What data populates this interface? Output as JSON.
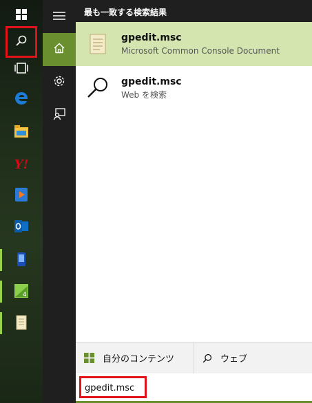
{
  "taskbar": {
    "items": [
      {
        "name": "start-button",
        "icon": "windows-logo-icon"
      },
      {
        "name": "search-button",
        "icon": "search-icon"
      },
      {
        "name": "task-view-button",
        "icon": "task-view-icon"
      },
      {
        "name": "edge-button",
        "icon": "edge-icon"
      },
      {
        "name": "file-explorer-button",
        "icon": "folder-icon"
      },
      {
        "name": "yahoo-button",
        "icon": "yahoo-icon",
        "label": "Y!"
      },
      {
        "name": "media-player-button",
        "icon": "media-player-icon"
      },
      {
        "name": "outlook-button",
        "icon": "outlook-icon"
      },
      {
        "name": "app-button-1",
        "icon": "app-icon"
      },
      {
        "name": "app-button-2",
        "icon": "app-icon"
      },
      {
        "name": "notepad-button",
        "icon": "notepad-icon"
      }
    ],
    "accent_color": "#9ad14a",
    "highlight_color": "#e2121b"
  },
  "rail": {
    "items": [
      {
        "name": "menu",
        "icon": "hamburger-icon"
      },
      {
        "name": "home",
        "icon": "home-icon"
      },
      {
        "name": "settings",
        "icon": "gear-icon"
      },
      {
        "name": "feedback",
        "icon": "feedback-icon"
      }
    ]
  },
  "panel": {
    "header": "最も一致する検索結果",
    "results": [
      {
        "title": "gpedit.msc",
        "subtitle": "Microsoft Common Console Document",
        "icon": "document-icon"
      },
      {
        "title": "gpedit.msc",
        "subtitle": "Web を検索",
        "icon": "search-icon"
      }
    ],
    "filters": {
      "my_content": "自分のコンテンツ",
      "web": "ウェブ"
    },
    "search": {
      "value": "gpedit.msc"
    },
    "colors": {
      "selected_bg": "#d4e5b0",
      "accent": "#6a8f2e"
    }
  }
}
